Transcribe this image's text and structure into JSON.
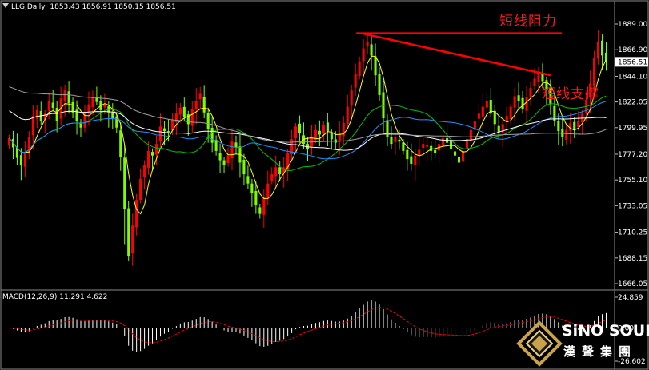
{
  "header": {
    "symbol": "LLG,Daily",
    "ohlc": "1853.43 1856.91 1850.15 1856.51"
  },
  "macd_header": "MACD(12,26,9) 11.291 4.622",
  "annotations": {
    "resistance": "短线阻力",
    "support": "短线支撑"
  },
  "logo": {
    "en": "SiNO SOUND",
    "cn": "漢聲集團"
  },
  "colors": {
    "background": "#000000",
    "bull_candle": "#ff0000",
    "bear_candle": "#7cfc00",
    "grid": "#3a3a3a",
    "trendline": "#ff0000",
    "macd_signal": "#ff0000",
    "macd_hist": "#ffffff",
    "price_tag_bg": "#ffffff"
  },
  "chart_data": [
    {
      "type": "candlestick",
      "title": "LLG,Daily",
      "y_ticks": [
        1889.0,
        1866.9,
        1844.1,
        1822.05,
        1799.95,
        1777.2,
        1755.1,
        1733.05,
        1710.25,
        1688.15,
        1666.05
      ],
      "y_tick_labels": [
        "1889.00",
        "1866.90",
        "1844.10",
        "1822.05",
        "1799.95",
        "1777.20",
        "1755.10",
        "1733.05",
        "1710.25",
        "1688.15",
        "1666.05"
      ],
      "ylim": [
        1666.05,
        1889.0
      ],
      "current_price": 1856.51,
      "current_price_label": "1856.51",
      "grid": true,
      "closes": [
        1791,
        1783,
        1774,
        1768,
        1778,
        1792,
        1810,
        1815,
        1806,
        1812,
        1823,
        1817,
        1806,
        1825,
        1832,
        1821,
        1813,
        1806,
        1800,
        1812,
        1820,
        1826,
        1822,
        1815,
        1820,
        1813,
        1808,
        1800,
        1775,
        1730,
        1690,
        1716,
        1738,
        1756,
        1768,
        1780,
        1776,
        1786,
        1801,
        1797,
        1796,
        1807,
        1812,
        1817,
        1809,
        1803,
        1816,
        1823,
        1829,
        1813,
        1799,
        1787,
        1780,
        1772,
        1768,
        1776,
        1788,
        1783,
        1770,
        1760,
        1752,
        1744,
        1734,
        1726,
        1740,
        1752,
        1760,
        1766,
        1760,
        1766,
        1778,
        1790,
        1801,
        1795,
        1786,
        1782,
        1792,
        1798,
        1794,
        1802,
        1797,
        1790,
        1787,
        1795,
        1804,
        1818,
        1832,
        1846,
        1857,
        1868,
        1874,
        1862,
        1845,
        1828,
        1808,
        1792,
        1786,
        1792,
        1788,
        1780,
        1773,
        1769,
        1776,
        1781,
        1786,
        1785,
        1780,
        1778,
        1786,
        1791,
        1787,
        1782,
        1776,
        1770,
        1780,
        1790,
        1798,
        1806,
        1812,
        1818,
        1823,
        1812,
        1803,
        1796,
        1803,
        1810,
        1818,
        1827,
        1823,
        1816,
        1826,
        1834,
        1842,
        1848,
        1840,
        1832,
        1820,
        1806,
        1797,
        1792,
        1798,
        1804,
        1798,
        1806,
        1812,
        1824,
        1838,
        1860,
        1874,
        1862,
        1857
      ],
      "x_labels": [],
      "series": [
        {
          "name": "",
          "color": "#ffff00"
        },
        {
          "name": "",
          "color": "#00c000"
        },
        {
          "name": "",
          "color": "#1e90ff"
        },
        {
          "name": "",
          "color": "#ffffff"
        },
        {
          "name": "",
          "color": "#a0a0a0"
        }
      ],
      "annotations": [
        {
          "text": "短线阻力",
          "kind": "resistance-line",
          "from_price": 1881,
          "to_price": 1881
        },
        {
          "text": "短线支撑",
          "kind": "support-line",
          "from_price": 1881,
          "to_price": 1845
        }
      ]
    },
    {
      "type": "bar",
      "title": "MACD(12,26,9) 11.291 4.622",
      "y_ticks": [
        24.859,
        0.0,
        -26.602
      ],
      "y_tick_labels": [
        "24.859",
        "0.00",
        "-26.602"
      ],
      "ylim": [
        -26.602,
        24.859
      ],
      "macd": 11.291,
      "signal": 4.622
    }
  ]
}
